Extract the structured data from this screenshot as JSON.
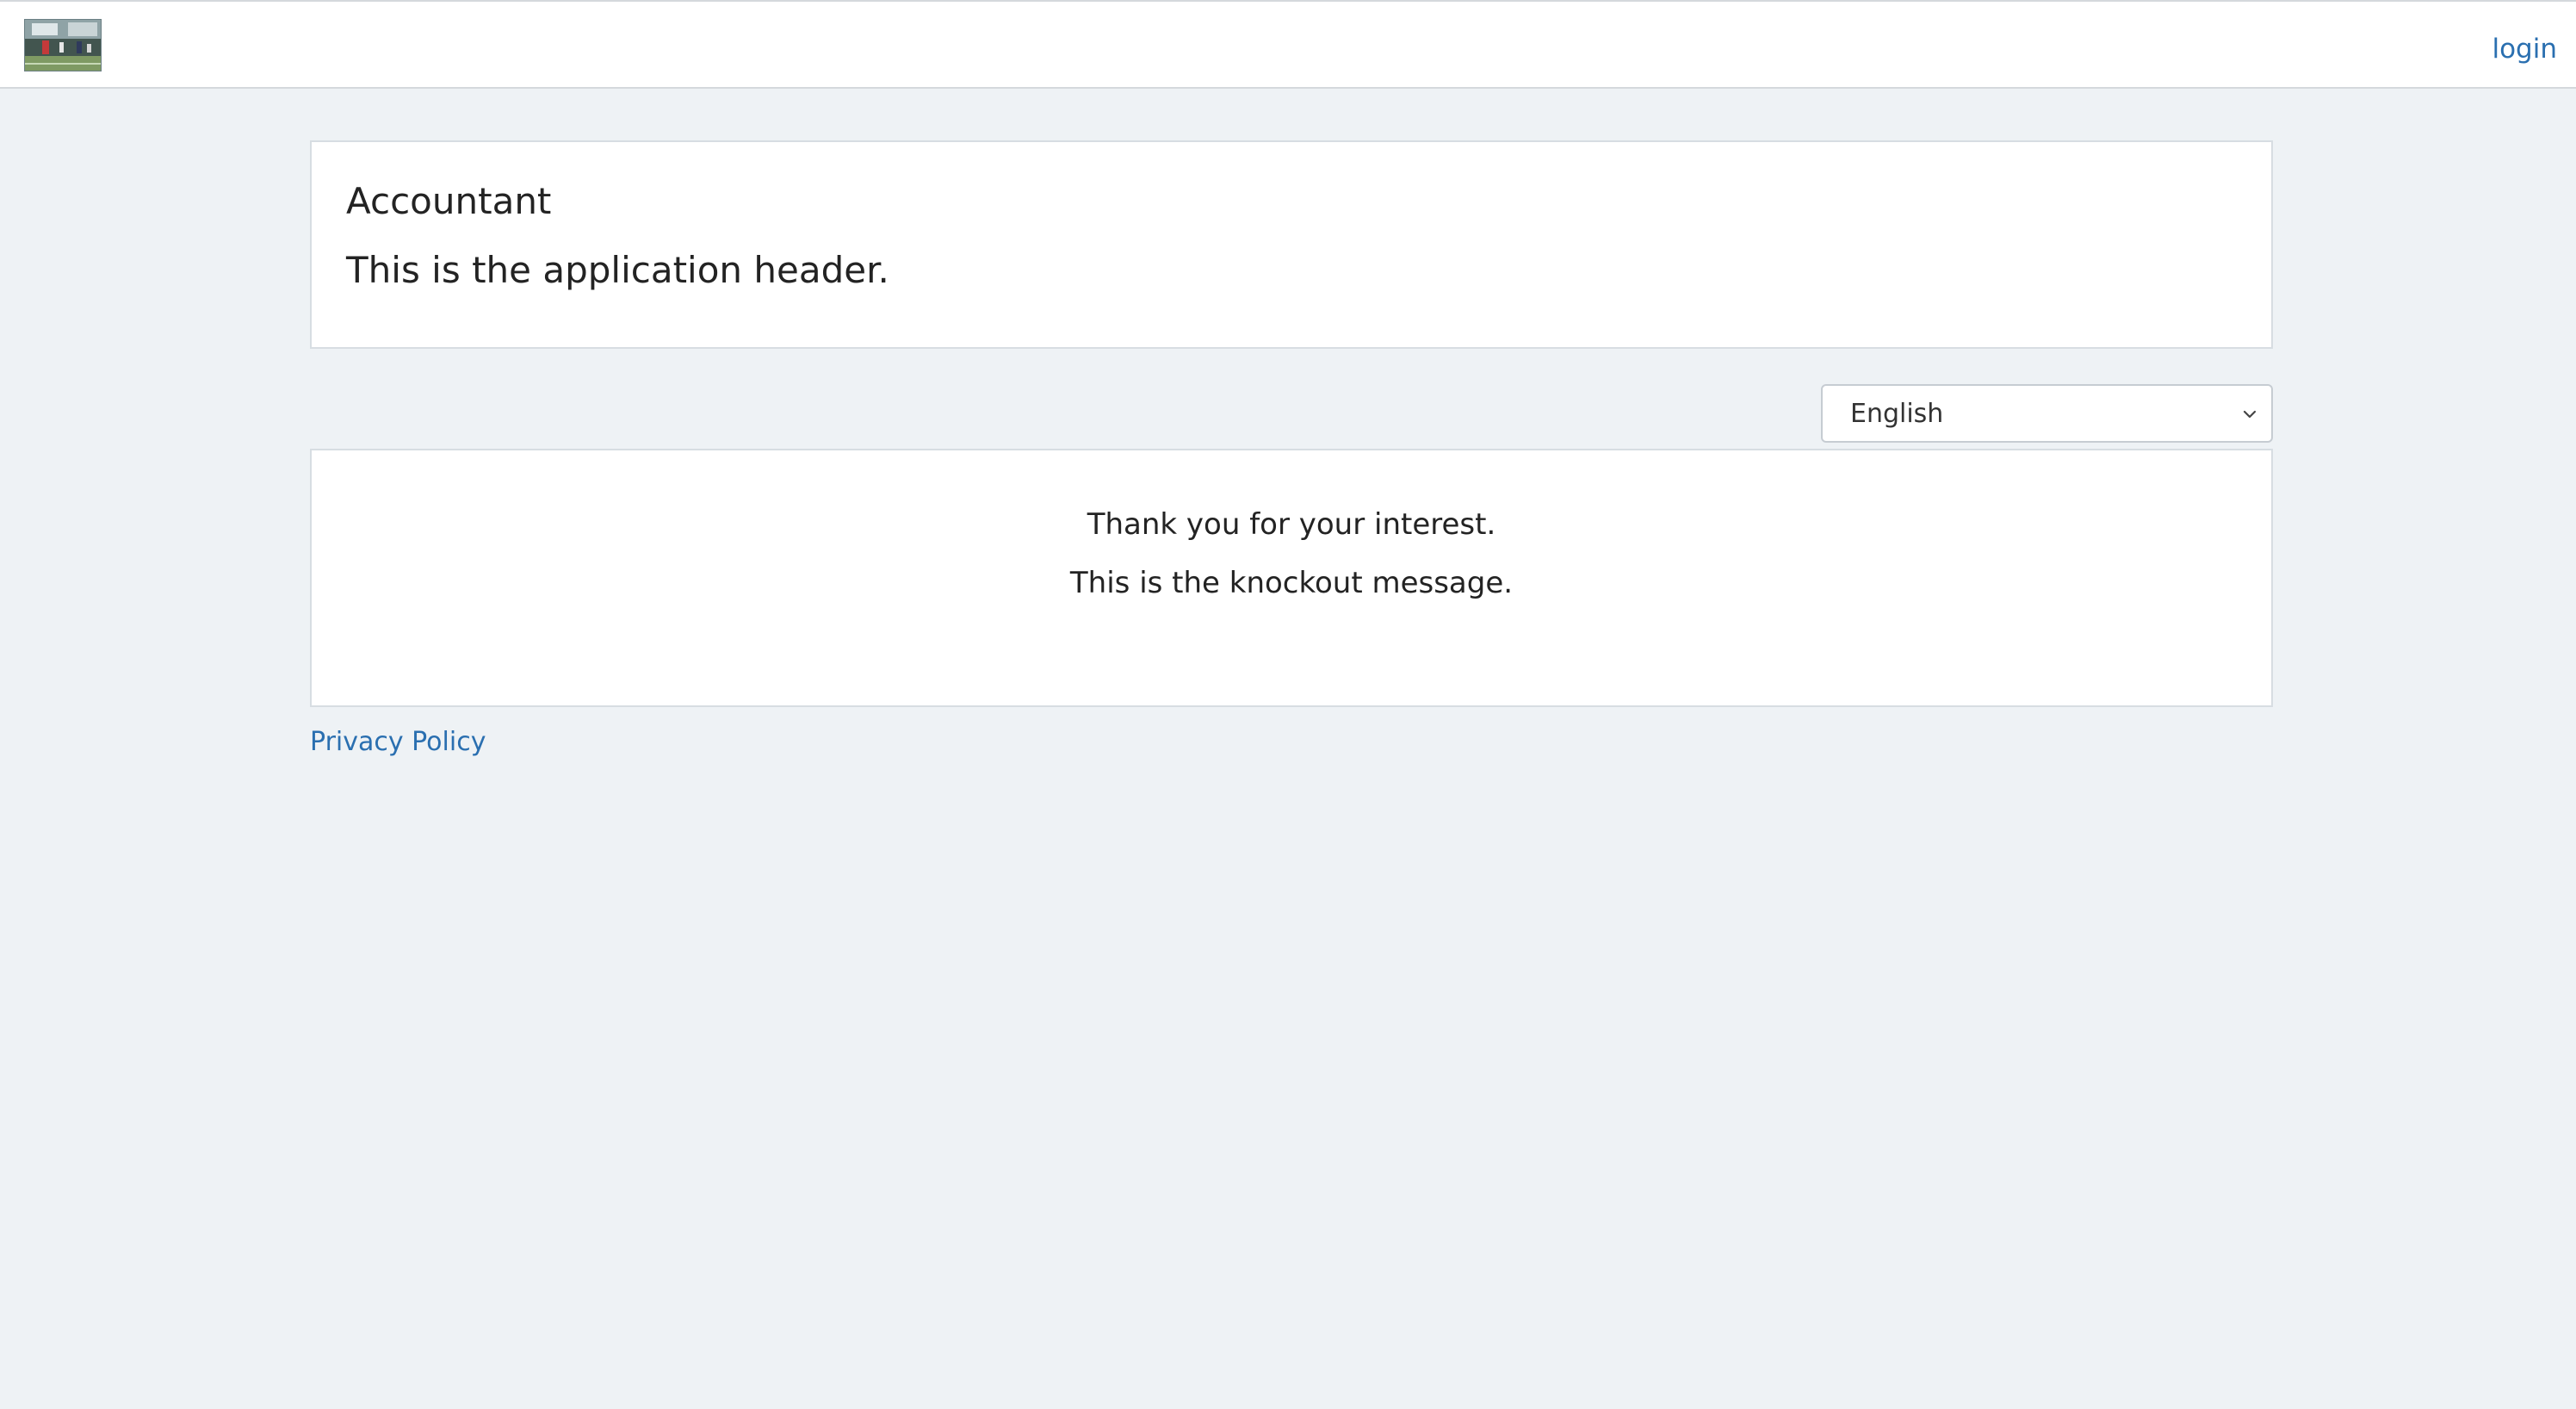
{
  "navbar": {
    "logo_icon": "soccer-field-photo-logo",
    "login_label": "login"
  },
  "header_card": {
    "title": "Accountant",
    "subtitle": "This is the application header."
  },
  "language_select": {
    "selected": "English",
    "icon": "chevron-down-icon"
  },
  "message_card": {
    "line1": "Thank you for your interest.",
    "line2": "This is the knockout message."
  },
  "footer": {
    "privacy_label": "Privacy Policy"
  },
  "colors": {
    "background": "#eef2f5",
    "link": "#2a6fb0",
    "card": "#ffffff",
    "border": "#d7dde2"
  }
}
